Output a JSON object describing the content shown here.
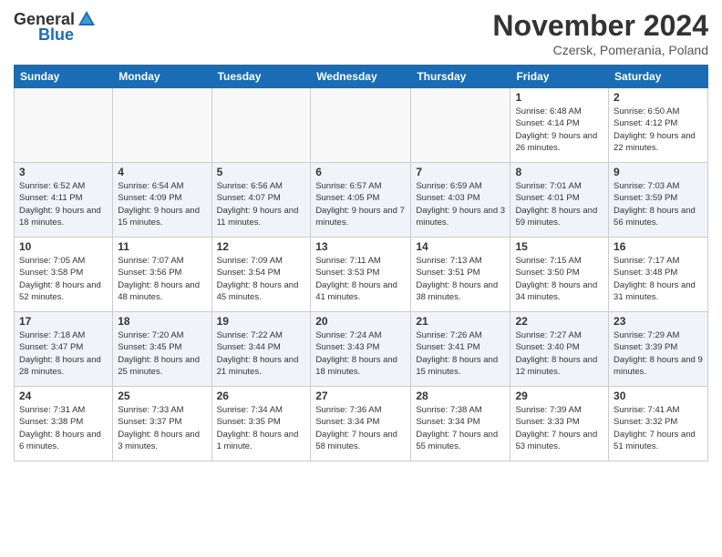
{
  "header": {
    "logo_general": "General",
    "logo_blue": "Blue",
    "title": "November 2024",
    "subtitle": "Czersk, Pomerania, Poland"
  },
  "days_of_week": [
    "Sunday",
    "Monday",
    "Tuesday",
    "Wednesday",
    "Thursday",
    "Friday",
    "Saturday"
  ],
  "weeks": [
    [
      {
        "day": "",
        "info": ""
      },
      {
        "day": "",
        "info": ""
      },
      {
        "day": "",
        "info": ""
      },
      {
        "day": "",
        "info": ""
      },
      {
        "day": "",
        "info": ""
      },
      {
        "day": "1",
        "info": "Sunrise: 6:48 AM\nSunset: 4:14 PM\nDaylight: 9 hours and 26 minutes."
      },
      {
        "day": "2",
        "info": "Sunrise: 6:50 AM\nSunset: 4:12 PM\nDaylight: 9 hours and 22 minutes."
      }
    ],
    [
      {
        "day": "3",
        "info": "Sunrise: 6:52 AM\nSunset: 4:11 PM\nDaylight: 9 hours and 18 minutes."
      },
      {
        "day": "4",
        "info": "Sunrise: 6:54 AM\nSunset: 4:09 PM\nDaylight: 9 hours and 15 minutes."
      },
      {
        "day": "5",
        "info": "Sunrise: 6:56 AM\nSunset: 4:07 PM\nDaylight: 9 hours and 11 minutes."
      },
      {
        "day": "6",
        "info": "Sunrise: 6:57 AM\nSunset: 4:05 PM\nDaylight: 9 hours and 7 minutes."
      },
      {
        "day": "7",
        "info": "Sunrise: 6:59 AM\nSunset: 4:03 PM\nDaylight: 9 hours and 3 minutes."
      },
      {
        "day": "8",
        "info": "Sunrise: 7:01 AM\nSunset: 4:01 PM\nDaylight: 8 hours and 59 minutes."
      },
      {
        "day": "9",
        "info": "Sunrise: 7:03 AM\nSunset: 3:59 PM\nDaylight: 8 hours and 56 minutes."
      }
    ],
    [
      {
        "day": "10",
        "info": "Sunrise: 7:05 AM\nSunset: 3:58 PM\nDaylight: 8 hours and 52 minutes."
      },
      {
        "day": "11",
        "info": "Sunrise: 7:07 AM\nSunset: 3:56 PM\nDaylight: 8 hours and 48 minutes."
      },
      {
        "day": "12",
        "info": "Sunrise: 7:09 AM\nSunset: 3:54 PM\nDaylight: 8 hours and 45 minutes."
      },
      {
        "day": "13",
        "info": "Sunrise: 7:11 AM\nSunset: 3:53 PM\nDaylight: 8 hours and 41 minutes."
      },
      {
        "day": "14",
        "info": "Sunrise: 7:13 AM\nSunset: 3:51 PM\nDaylight: 8 hours and 38 minutes."
      },
      {
        "day": "15",
        "info": "Sunrise: 7:15 AM\nSunset: 3:50 PM\nDaylight: 8 hours and 34 minutes."
      },
      {
        "day": "16",
        "info": "Sunrise: 7:17 AM\nSunset: 3:48 PM\nDaylight: 8 hours and 31 minutes."
      }
    ],
    [
      {
        "day": "17",
        "info": "Sunrise: 7:18 AM\nSunset: 3:47 PM\nDaylight: 8 hours and 28 minutes."
      },
      {
        "day": "18",
        "info": "Sunrise: 7:20 AM\nSunset: 3:45 PM\nDaylight: 8 hours and 25 minutes."
      },
      {
        "day": "19",
        "info": "Sunrise: 7:22 AM\nSunset: 3:44 PM\nDaylight: 8 hours and 21 minutes."
      },
      {
        "day": "20",
        "info": "Sunrise: 7:24 AM\nSunset: 3:43 PM\nDaylight: 8 hours and 18 minutes."
      },
      {
        "day": "21",
        "info": "Sunrise: 7:26 AM\nSunset: 3:41 PM\nDaylight: 8 hours and 15 minutes."
      },
      {
        "day": "22",
        "info": "Sunrise: 7:27 AM\nSunset: 3:40 PM\nDaylight: 8 hours and 12 minutes."
      },
      {
        "day": "23",
        "info": "Sunrise: 7:29 AM\nSunset: 3:39 PM\nDaylight: 8 hours and 9 minutes."
      }
    ],
    [
      {
        "day": "24",
        "info": "Sunrise: 7:31 AM\nSunset: 3:38 PM\nDaylight: 8 hours and 6 minutes."
      },
      {
        "day": "25",
        "info": "Sunrise: 7:33 AM\nSunset: 3:37 PM\nDaylight: 8 hours and 3 minutes."
      },
      {
        "day": "26",
        "info": "Sunrise: 7:34 AM\nSunset: 3:35 PM\nDaylight: 8 hours and 1 minute."
      },
      {
        "day": "27",
        "info": "Sunrise: 7:36 AM\nSunset: 3:34 PM\nDaylight: 7 hours and 58 minutes."
      },
      {
        "day": "28",
        "info": "Sunrise: 7:38 AM\nSunset: 3:34 PM\nDaylight: 7 hours and 55 minutes."
      },
      {
        "day": "29",
        "info": "Sunrise: 7:39 AM\nSunset: 3:33 PM\nDaylight: 7 hours and 53 minutes."
      },
      {
        "day": "30",
        "info": "Sunrise: 7:41 AM\nSunset: 3:32 PM\nDaylight: 7 hours and 51 minutes."
      }
    ]
  ]
}
